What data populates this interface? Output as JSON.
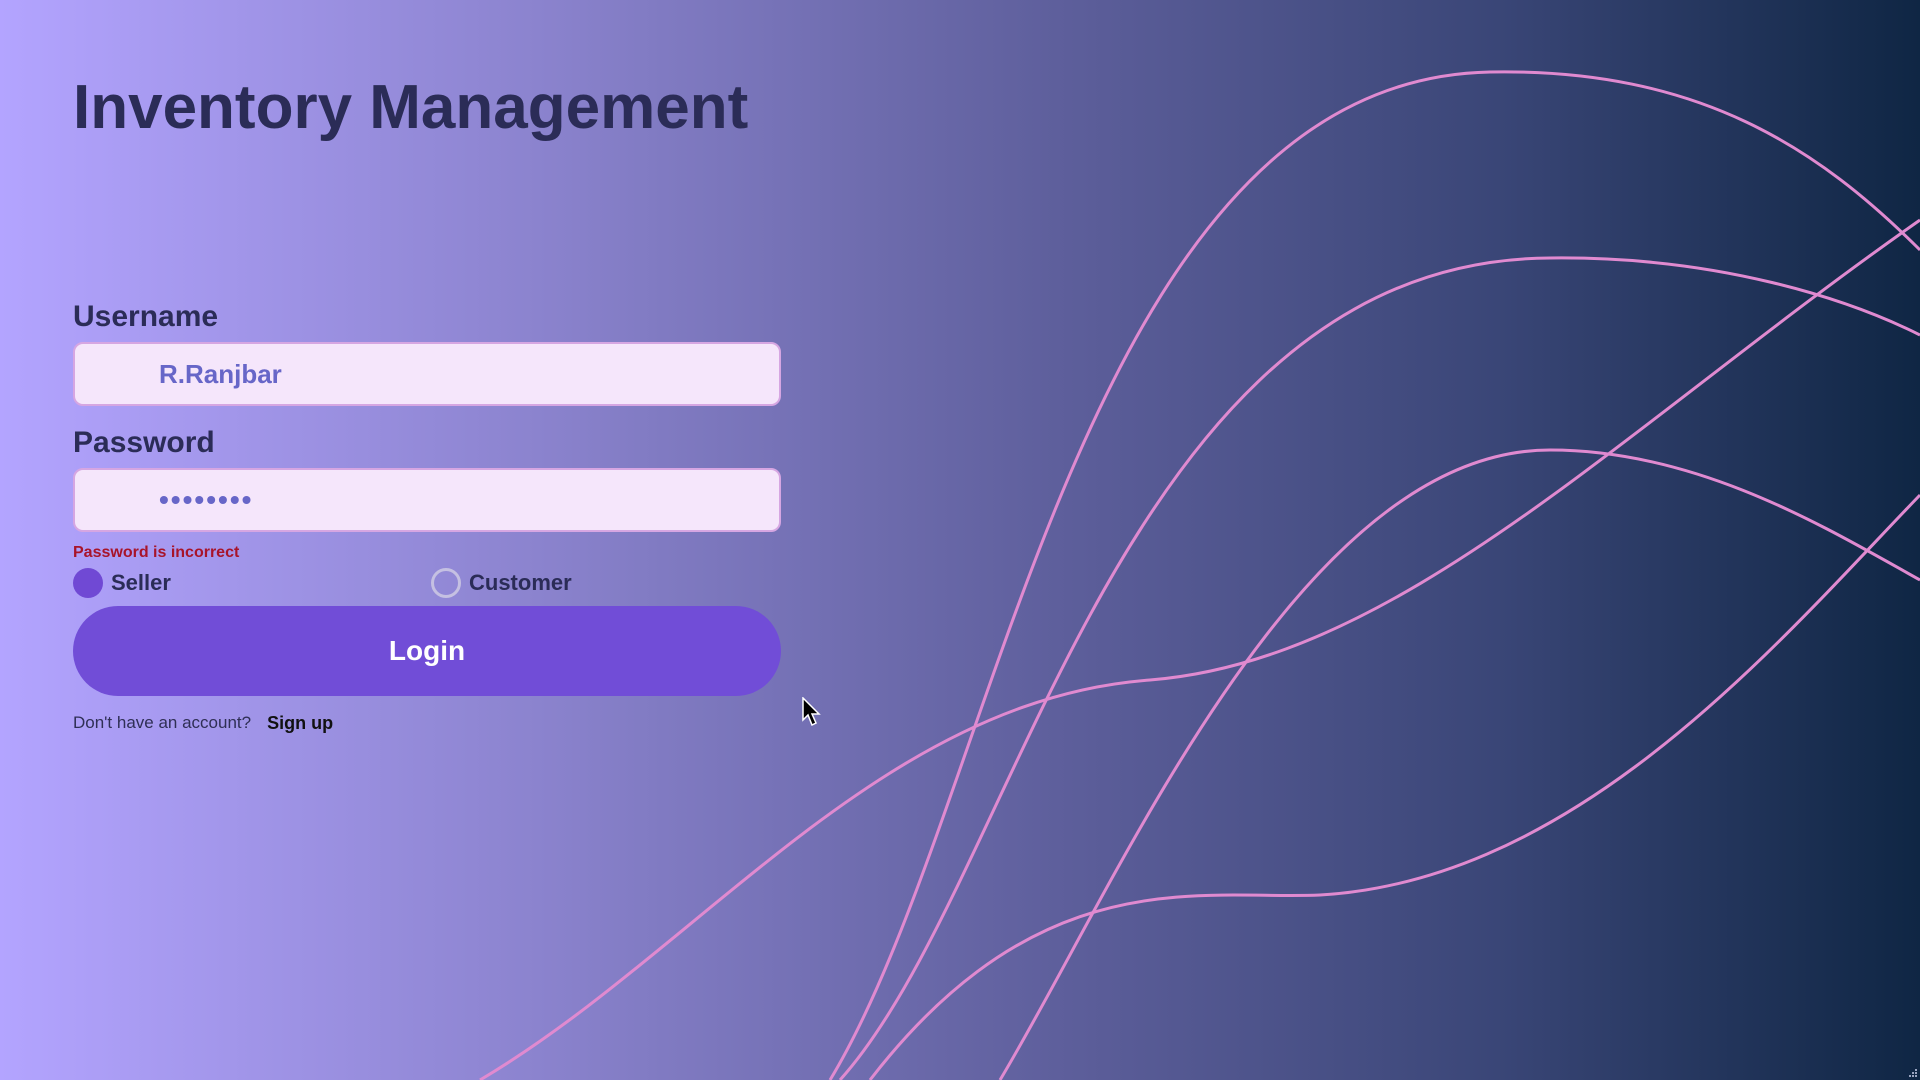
{
  "app": {
    "title": "Inventory Management"
  },
  "form": {
    "username_label": "Username",
    "username_value": "R.Ranjbar",
    "password_label": "Password",
    "password_value": "••••••••",
    "error_message": "Password is incorrect",
    "role_options": [
      {
        "label": "Seller",
        "selected": true
      },
      {
        "label": "Customer",
        "selected": false
      }
    ],
    "login_label": "Login",
    "signup_prompt": "Don't have an account?",
    "signup_link": "Sign up"
  },
  "colors": {
    "accent": "#714dd7",
    "title": "#2b2c57",
    "input_bg": "#f5e6fb",
    "error": "#a8142a",
    "wave": "#e08ad0"
  },
  "icons": {
    "cursor": "mouse-pointer-icon",
    "resize": "resize-grip-icon"
  }
}
